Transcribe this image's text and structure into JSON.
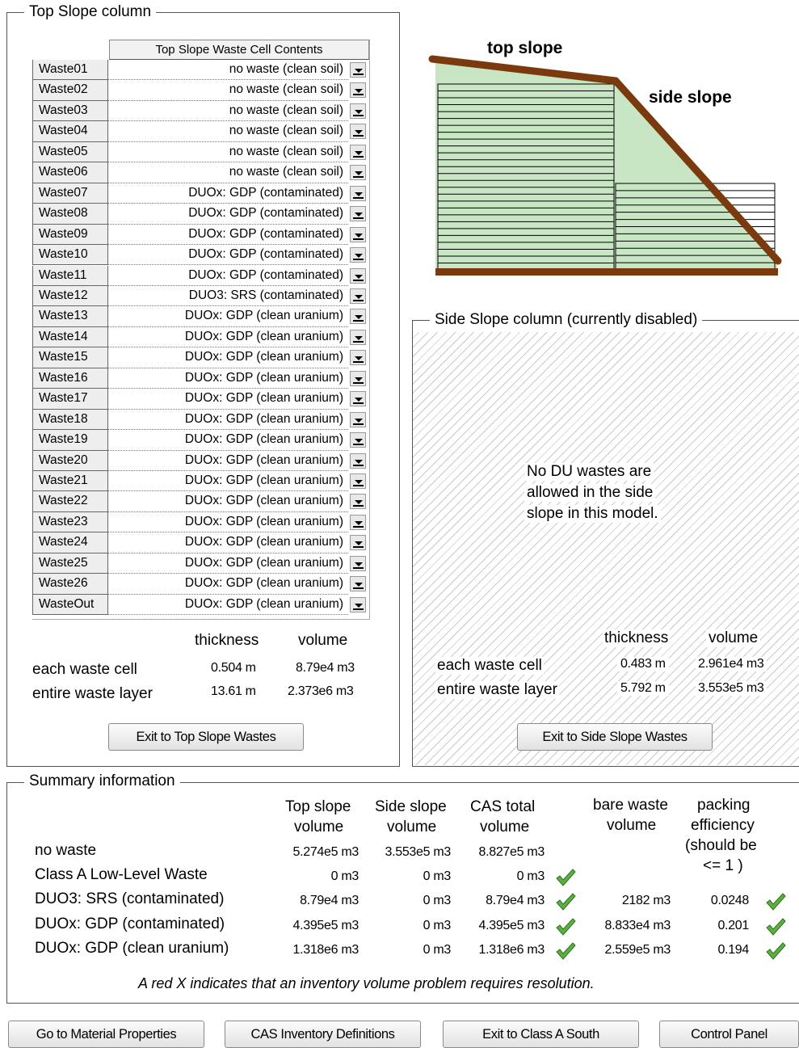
{
  "top_slope": {
    "title": "Top Slope column",
    "table_header": "Top Slope Waste Cell Contents",
    "rows": [
      {
        "label": "Waste01",
        "value": "no waste (clean soil)"
      },
      {
        "label": "Waste02",
        "value": "no waste (clean soil)"
      },
      {
        "label": "Waste03",
        "value": "no waste (clean soil)"
      },
      {
        "label": "Waste04",
        "value": "no waste (clean soil)"
      },
      {
        "label": "Waste05",
        "value": "no waste (clean soil)"
      },
      {
        "label": "Waste06",
        "value": "no waste (clean soil)"
      },
      {
        "label": "Waste07",
        "value": "DUOx: GDP (contaminated)"
      },
      {
        "label": "Waste08",
        "value": "DUOx: GDP (contaminated)"
      },
      {
        "label": "Waste09",
        "value": "DUOx: GDP (contaminated)"
      },
      {
        "label": "Waste10",
        "value": "DUOx: GDP (contaminated)"
      },
      {
        "label": "Waste11",
        "value": "DUOx: GDP (contaminated)"
      },
      {
        "label": "Waste12",
        "value": "DUO3: SRS (contaminated)"
      },
      {
        "label": "Waste13",
        "value": "DUOx: GDP (clean uranium)"
      },
      {
        "label": "Waste14",
        "value": "DUOx: GDP (clean uranium)"
      },
      {
        "label": "Waste15",
        "value": "DUOx: GDP (clean uranium)"
      },
      {
        "label": "Waste16",
        "value": "DUOx: GDP (clean uranium)"
      },
      {
        "label": "Waste17",
        "value": "DUOx: GDP (clean uranium)"
      },
      {
        "label": "Waste18",
        "value": "DUOx: GDP (clean uranium)"
      },
      {
        "label": "Waste19",
        "value": "DUOx: GDP (clean uranium)"
      },
      {
        "label": "Waste20",
        "value": "DUOx: GDP (clean uranium)"
      },
      {
        "label": "Waste21",
        "value": "DUOx: GDP (clean uranium)"
      },
      {
        "label": "Waste22",
        "value": "DUOx: GDP (clean uranium)"
      },
      {
        "label": "Waste23",
        "value": "DUOx: GDP (clean uranium)"
      },
      {
        "label": "Waste24",
        "value": "DUOx: GDP (clean uranium)"
      },
      {
        "label": "Waste25",
        "value": "DUOx: GDP (clean uranium)"
      },
      {
        "label": "Waste26",
        "value": "DUOx: GDP (clean uranium)"
      },
      {
        "label": "WasteOut",
        "value": "DUOx: GDP (clean uranium)"
      }
    ],
    "thickness_header": "thickness",
    "volume_header": "volume",
    "each_cell_label": "each waste cell",
    "each_cell_thickness": "0.504 m",
    "each_cell_volume": "8.79e4 m3",
    "layer_label": "entire waste layer",
    "layer_thickness": "13.61 m",
    "layer_volume": "2.373e6 m3",
    "exit_button": "Exit to Top Slope Wastes"
  },
  "diagram": {
    "top_slope_label": "top slope",
    "side_slope_label": "side slope",
    "colors": {
      "cover": "#7a3a0e",
      "fill": "#c8e6c4",
      "lines": "#000000"
    }
  },
  "side_slope": {
    "title": "Side Slope column (currently disabled)",
    "message_line1": "No DU wastes are",
    "message_line2": "allowed in the side",
    "message_line3": "slope in this model.",
    "thickness_header": "thickness",
    "volume_header": "volume",
    "each_cell_label": "each waste cell",
    "each_cell_thickness": "0.483 m",
    "each_cell_volume": "2.961e4 m3",
    "layer_label": "entire waste layer",
    "layer_thickness": "5.792 m",
    "layer_volume": "3.553e5 m3",
    "exit_button": "Exit to Side Slope Wastes"
  },
  "summary": {
    "title": "Summary information",
    "headers": {
      "top_line1": "Top slope",
      "top_line2": "volume",
      "side_line1": "Side slope",
      "side_line2": "volume",
      "cas_line1": "CAS total",
      "cas_line2": "volume",
      "bare_line1": "bare waste",
      "bare_line2": "volume",
      "pack_line1": "packing",
      "pack_line2": "efficiency",
      "pack_line3": "(should be",
      "pack_line4": "<= 1 )"
    },
    "rows": [
      {
        "label": "no waste",
        "top": "5.274e5 m3",
        "side": "3.553e5 m3",
        "cas": "8.827e5 m3",
        "bare": "",
        "pack": ""
      },
      {
        "label": "Class A Low-Level Waste",
        "top": "0 m3",
        "side": "0 m3",
        "cas": "0 m3",
        "bare": "",
        "pack": ""
      },
      {
        "label": "DUO3: SRS (contaminated)",
        "top": "8.79e4 m3",
        "side": "0 m3",
        "cas": "8.79e4 m3",
        "bare": "2182 m3",
        "pack": "0.0248"
      },
      {
        "label": "DUOx: GDP (contaminated)",
        "top": "4.395e5 m3",
        "side": "0 m3",
        "cas": "4.395e5 m3",
        "bare": "8.833e4 m3",
        "pack": "0.201"
      },
      {
        "label": "DUOx: GDP (clean uranium)",
        "top": "1.318e6 m3",
        "side": "0 m3",
        "cas": "1.318e6 m3",
        "bare": "2.559e5 m3",
        "pack": "0.194"
      }
    ],
    "note": "A red X indicates that an inventory volume problem requires resolution.",
    "check_color": "#5cb040"
  },
  "bottom_buttons": {
    "material": "Go to Material Properties",
    "cas": "CAS Inventory Definitions",
    "exit_south": "Exit to Class A South",
    "control": "Control Panel"
  }
}
